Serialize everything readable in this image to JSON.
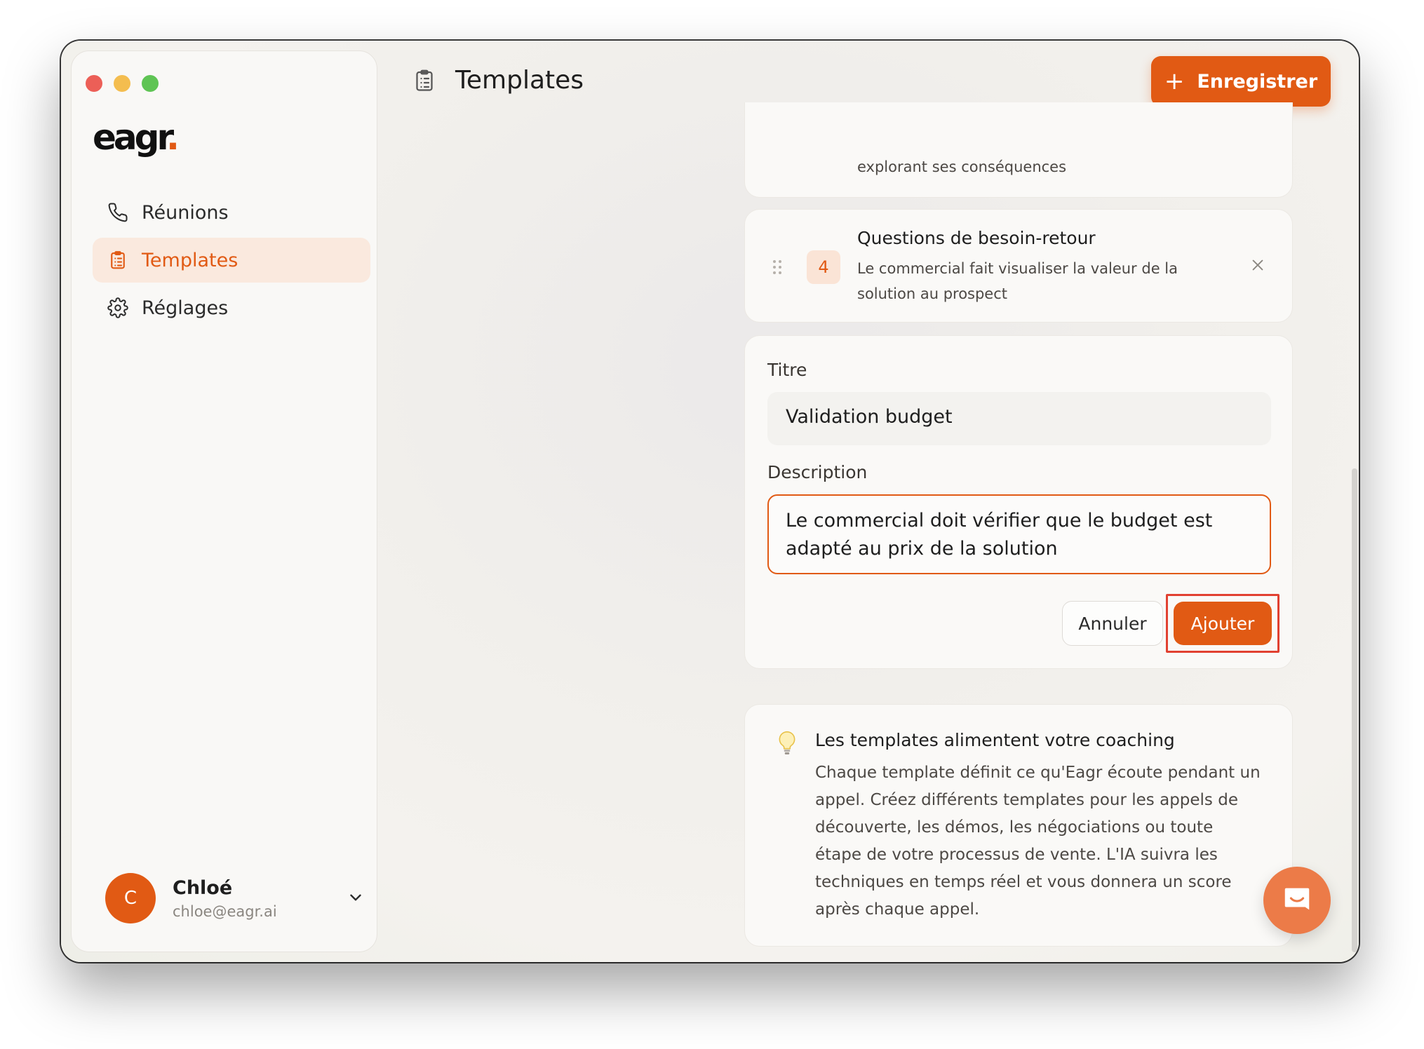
{
  "app": {
    "logo": "eagr",
    "logo_dot": "."
  },
  "sidebar": {
    "items": [
      {
        "label": "Réunions",
        "icon": "phone-icon",
        "active": false
      },
      {
        "label": "Templates",
        "icon": "clipboard-icon",
        "active": true
      },
      {
        "label": "Réglages",
        "icon": "gear-icon",
        "active": false
      }
    ],
    "user": {
      "initial": "C",
      "name": "Chloé",
      "email": "chloe@eagr.ai"
    }
  },
  "header": {
    "title": "Templates",
    "save_plus": "+",
    "save_label": "Enregistrer"
  },
  "techniques": {
    "prev_desc_tail": "explorant ses conséquences",
    "current": {
      "number": "4",
      "title": "Questions de besoin-retour",
      "description": "Le commercial fait visualiser la valeur de la solution au prospect"
    }
  },
  "form": {
    "title_label": "Titre",
    "title_value": "Validation budget",
    "description_label": "Description",
    "description_value": "Le commercial doit vérifier que le budget est adapté au prix de la solution",
    "cancel_label": "Annuler",
    "add_label": "Ajouter"
  },
  "info": {
    "title": "Les templates alimentent votre coaching",
    "text": "Chaque template définit ce qu'Eagr écoute pendant un appel. Créez différents templates pour les appels de découverte, les démos, les négociations ou toute étape de votre processus de vente. L'IA suivra les techniques en temps réel et vous donnera un score après chaque appel."
  },
  "colors": {
    "accent": "#e15a14",
    "active_bg": "#fae9de",
    "highlight": "#e14131"
  }
}
